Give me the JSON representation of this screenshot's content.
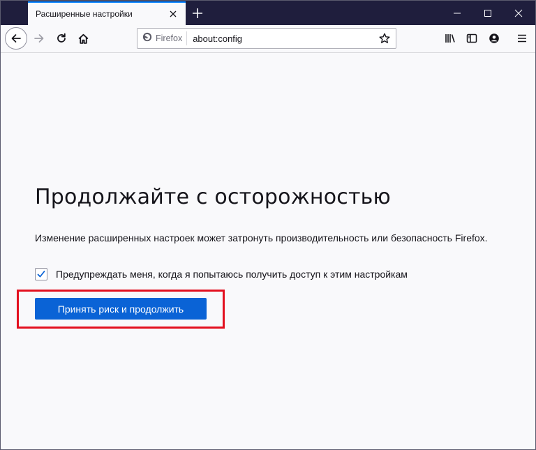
{
  "tab": {
    "title": "Расширенные настройки"
  },
  "window_controls": [
    "minimize",
    "maximize",
    "close"
  ],
  "urlbar": {
    "identity_label": "Firefox",
    "url": "about:config"
  },
  "icons": {
    "back": "back-arrow-icon",
    "forward": "forward-arrow-icon",
    "reload": "reload-icon",
    "home": "home-icon",
    "bookmark": "star-icon",
    "library": "library-icon",
    "sidebar": "sidebar-icon",
    "account": "account-icon",
    "menu": "hamburger-menu-icon"
  },
  "page": {
    "heading": "Продолжайте с осторожностью",
    "description": "Изменение расширенных настроек может затронуть производительность или безопасность Firefox.",
    "checkbox_label": "Предупреждать меня, когда я попытаюсь получить доступ к этим настройкам",
    "checkbox_checked": true,
    "accept_button": "Принять риск и продолжить"
  },
  "colors": {
    "tabstrip": "#1f1e3d",
    "accent": "#0a84ff",
    "button": "#0a63d6",
    "highlight": "#e3101f"
  }
}
